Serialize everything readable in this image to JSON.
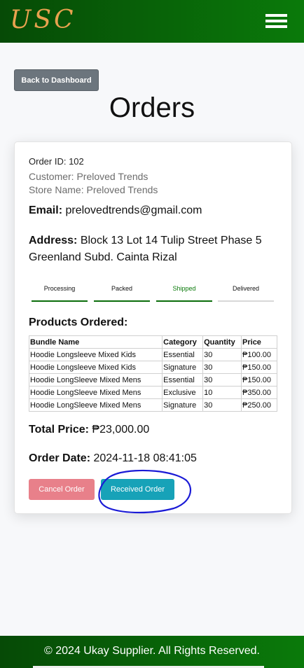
{
  "header": {
    "logo_text": "USC"
  },
  "nav": {
    "back_label": "Back to Dashboard"
  },
  "page": {
    "title": "Orders"
  },
  "order": {
    "id_line": "Order ID: 102",
    "customer_line": "Customer: Preloved Trends",
    "store_line": "Store Name: Preloved Trends",
    "email_label": "Email:",
    "email_value": "prelovedtrends@gmail.com",
    "address_label": "Address:",
    "address_value": "Block 13 Lot 14 Tulip Street Phase 5 Greenland Subd. Cainta Rizal",
    "status_steps": [
      "Processing",
      "Packed",
      "Shipped",
      "Delivered"
    ],
    "current_step": "Shipped",
    "products_heading": "Products Ordered:",
    "table_headers": [
      "Bundle Name",
      "Category",
      "Quantity",
      "Price"
    ],
    "table_rows": [
      [
        "Hoodie Longsleeve Mixed Kids",
        "Essential",
        "30",
        "₱100.00"
      ],
      [
        "Hoodie Longsleeve Mixed Kids",
        "Signature",
        "30",
        "₱150.00"
      ],
      [
        "Hoodie LongSleeve Mixed Mens",
        "Essential",
        "30",
        "₱150.00"
      ],
      [
        "Hoodie LongSleeve Mixed Mens",
        "Exclusive",
        "10",
        "₱350.00"
      ],
      [
        "Hoodie LongSleeve Mixed Mens",
        "Signature",
        "30",
        "₱250.00"
      ]
    ],
    "total_label": "Total Price:",
    "total_value": "₱23,000.00",
    "date_label": "Order Date:",
    "date_value": "2024-11-18 08:41:05",
    "cancel_label": "Cancel Order",
    "received_label": "Received Order"
  },
  "footer": {
    "text": "© 2024 Ukay Supplier. All Rights Reserved."
  },
  "colors": {
    "header_dark": "#064a06",
    "header_light": "#0a7a0a",
    "logo": "#e8a24f",
    "back_button": "#6c757d",
    "cancel_button": "#e8808a",
    "received_button": "#17a2b8",
    "annotation": "#1a1ad6"
  }
}
